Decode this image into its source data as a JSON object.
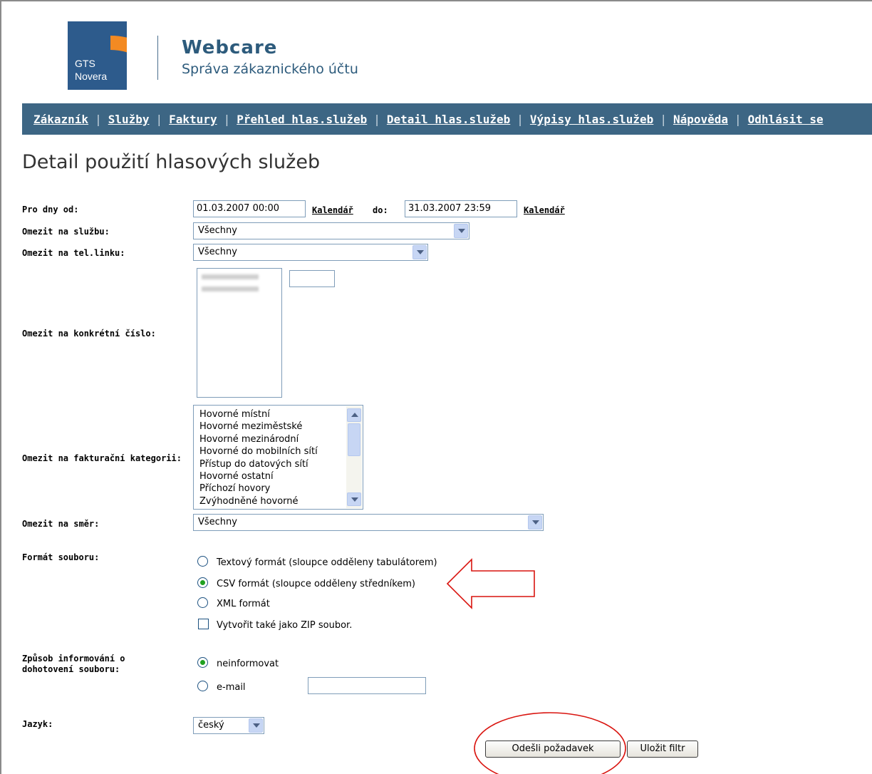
{
  "header": {
    "logo_line1": "GTS",
    "logo_line2": "Novera",
    "app_title": "Webcare",
    "app_subtitle": "Správa zákaznického účtu"
  },
  "nav": {
    "items": [
      "Zákazník",
      "Služby",
      "Faktury",
      "Přehled hlas.služeb",
      "Detail hlas.služeb",
      "Výpisy hlas.služeb",
      "Nápověda",
      "Odhlásit se"
    ]
  },
  "page_title": "Detail použití hlasových služeb",
  "form": {
    "date_label": "Pro dny od:",
    "date_from": "01.03.2007 00:00",
    "calendar_link": "Kalendář",
    "date_to_label": "do:",
    "date_to": "31.03.2007 23:59",
    "service_label": "Omezit na službu:",
    "service_value": "Všechny",
    "line_label": "Omezit na tel.linku:",
    "line_value": "Všechny",
    "number_label": "Omezit na konkrétní číslo:",
    "billing_label": "Omezit na fakturační kategorii:",
    "billing_categories": [
      "Hovorné místní",
      "Hovorné meziměstské",
      "Hovorné mezinárodní",
      "Hovorné do mobilních sítí",
      "Přístup do datových sítí",
      "Hovorné ostatní",
      "Příchozí hovory",
      "Zvýhodněné hovorné"
    ],
    "direction_label": "Omezit na směr:",
    "direction_value": "Všechny",
    "format_label": "Formát souboru:",
    "format_options": [
      "Textový formát (sloupce odděleny tabulátorem)",
      "CSV formát (sloupce odděleny středníkem)",
      "XML formát"
    ],
    "format_selected_index": 1,
    "zip_label": "Vytvořit také jako ZIP soubor.",
    "notify_label_line1": "Způsob informování o",
    "notify_label_line2": "dohotovení souboru:",
    "notify_options": [
      "neinformovat",
      "e-mail"
    ],
    "notify_email_value": "",
    "language_label": "Jazyk:",
    "language_value": "český",
    "submit_label": "Odešli požadavek",
    "save_label": "Uložit filtr"
  },
  "annotation_color": "#d9140f"
}
